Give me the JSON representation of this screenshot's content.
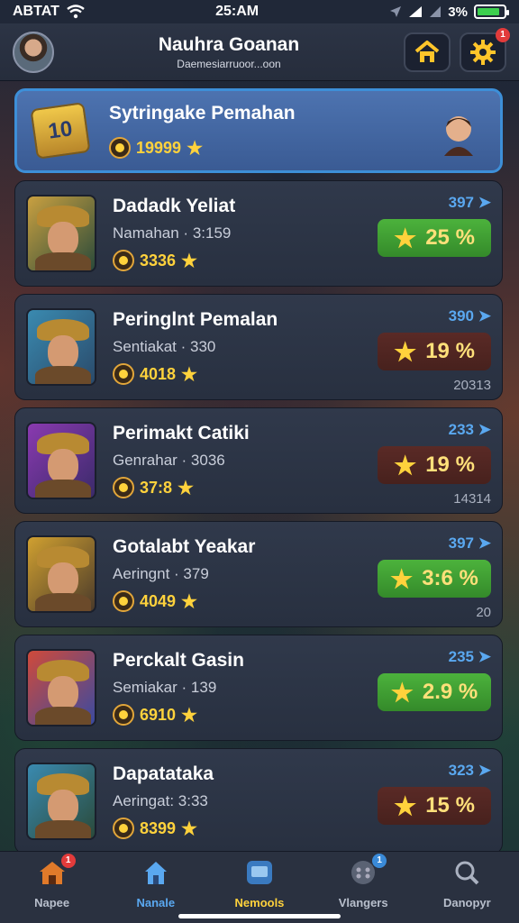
{
  "status": {
    "carrier": "ABTAT",
    "time": "25:AM",
    "battery_text": "3%",
    "battery_level": 0.85
  },
  "header": {
    "title": "Nauhra Goanan",
    "subtitle": "Daemesiarruoor...oon",
    "home_badge": "",
    "settings_badge": "1"
  },
  "featured": {
    "badge_text": "10",
    "title": "Sytringake Pemahan",
    "coins": "19999"
  },
  "rows": [
    {
      "title": "Dadadk Yeliat",
      "sub": "Namahan · 3:159",
      "coins": "3336",
      "score": "397",
      "percent": "25 %",
      "pill_color": "green",
      "extra": "",
      "palette": [
        "#c9a040",
        "#2a4a3a"
      ]
    },
    {
      "title": "Peringlnt Pemalan",
      "sub": "Sentiakat · 330",
      "coins": "4018",
      "score": "390",
      "percent": "19 %",
      "pill_color": "brown",
      "extra": "20313",
      "palette": [
        "#3a8ab0",
        "#2a4a6a"
      ]
    },
    {
      "title": "Perimakt Catiki",
      "sub": "Genrahar · 3036",
      "coins": "37:8",
      "score": "233",
      "percent": "19 %",
      "pill_color": "brown",
      "extra": "14314",
      "palette": [
        "#8a3ab0",
        "#3a2a6a"
      ]
    },
    {
      "title": "Gotalabt Yeakar",
      "sub": "Aeringnt · 379",
      "coins": "4049",
      "score": "397",
      "percent": "3:6 %",
      "pill_color": "green",
      "extra": "20",
      "palette": [
        "#d0a030",
        "#4a3a2a"
      ]
    },
    {
      "title": "Perckalt Gasin",
      "sub": "Semiakar · 139",
      "coins": "6910",
      "score": "235",
      "percent": "2.9 %",
      "pill_color": "green",
      "extra": "",
      "palette": [
        "#d04a3a",
        "#3a4aa0"
      ]
    },
    {
      "title": "Dapatataka",
      "sub": "Aeringat: 3:33",
      "coins": "8399",
      "score": "323",
      "percent": "15 %",
      "pill_color": "brown",
      "extra": "",
      "palette": [
        "#3a8ab0",
        "#2a4a3a"
      ]
    }
  ],
  "tabs": [
    {
      "label": "Napee",
      "icon": "home-icon",
      "color": "dim",
      "badge": "1"
    },
    {
      "label": "Nanale",
      "icon": "shop-icon",
      "color": "blue",
      "badge": ""
    },
    {
      "label": "Nemools",
      "icon": "tablet-icon",
      "color": "active",
      "badge": ""
    },
    {
      "label": "Vlangers",
      "icon": "controller-icon",
      "color": "dim",
      "badge": "1"
    },
    {
      "label": "Danopyr",
      "icon": "search-icon",
      "color": "dim",
      "badge": ""
    }
  ]
}
